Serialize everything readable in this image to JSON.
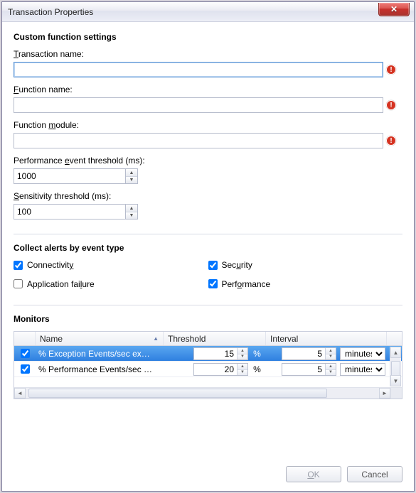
{
  "window": {
    "title": "Transaction Properties"
  },
  "sections": {
    "custom": "Custom function settings",
    "alerts": "Collect alerts by event type",
    "monitors": "Monitors"
  },
  "fields": {
    "transaction_name": {
      "label_pre": "",
      "mnemonic": "T",
      "label_post": "ransaction name:",
      "value": ""
    },
    "function_name": {
      "label_pre": "",
      "mnemonic": "F",
      "label_post": "unction name:",
      "value": ""
    },
    "function_module": {
      "label_pre": "Function ",
      "mnemonic": "m",
      "label_post": "odule:",
      "value": ""
    },
    "perf_threshold": {
      "label_pre": "Performance ",
      "mnemonic": "e",
      "label_post": "vent threshold (ms):",
      "value": "1000"
    },
    "sensitivity": {
      "label_pre": "",
      "mnemonic": "S",
      "label_post": "ensitivity threshold (ms):",
      "value": "100"
    }
  },
  "checks": {
    "connectivity": {
      "pre": "Connectivit",
      "mnemonic": "y",
      "post": "",
      "checked": true
    },
    "security": {
      "pre": "Sec",
      "mnemonic": "u",
      "post": "rity",
      "checked": true
    },
    "app_failure": {
      "pre": "Application fai",
      "mnemonic": "l",
      "post": "ure",
      "checked": false
    },
    "performance": {
      "pre": "Perf",
      "mnemonic": "o",
      "post": "rmance",
      "checked": true
    }
  },
  "monitors": {
    "columns": {
      "name": "Name",
      "threshold": "Threshold",
      "interval": "Interval"
    },
    "unit_pct": "%",
    "interval_unit": "minutes",
    "rows": [
      {
        "name": "% Exception Events/sec ex…",
        "threshold": "15",
        "interval": "5",
        "checked": true,
        "selected": true
      },
      {
        "name": "% Performance Events/sec …",
        "threshold": "20",
        "interval": "5",
        "checked": true,
        "selected": false
      }
    ]
  },
  "buttons": {
    "ok_pre": "",
    "ok_m": "O",
    "ok_post": "K",
    "cancel": "Cancel"
  }
}
